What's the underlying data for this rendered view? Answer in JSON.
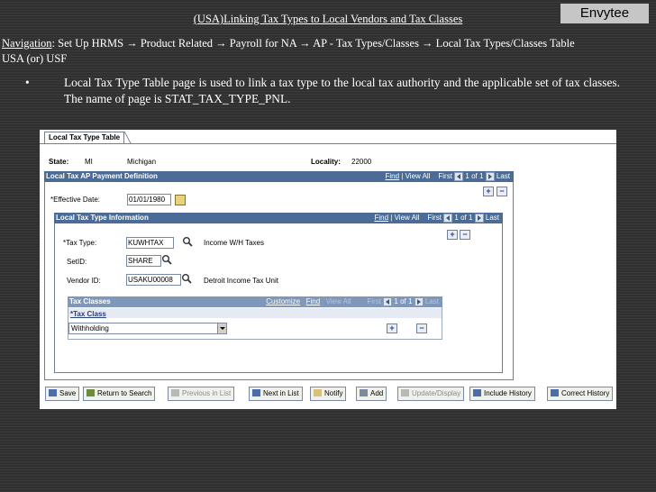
{
  "slide": {
    "title": "(USA)Linking Tax Types to Local Vendors and Tax Classes",
    "brand": "Envytee",
    "nav_label": "Navigation",
    "nav_text": ": Set Up HRMS → Product Related → Payroll for NA → AP - Tax Types/Classes → Local Tax Types/Classes Table USA (or) USF",
    "bullet": "Local Tax Type Table page is used to link a tax type to the local tax authority and the applicable set of tax classes. The name of page is STAT_TAX_TYPE_PNL."
  },
  "page": {
    "tab": "Local Tax Type Table",
    "state_label": "State:",
    "state_code": "MI",
    "state_name": "Michigan",
    "locality_label": "Locality:",
    "locality_value": "22000",
    "ap_section": {
      "title": "Local Tax AP Payment Definition",
      "find": "Find",
      "view_all": "View All",
      "first": "First",
      "count": "1 of 1",
      "last": "Last",
      "effdt_label": "*Effective Date:",
      "effdt_value": "01/01/1980"
    },
    "info_section": {
      "title": "Local Tax Type Information",
      "find": "Find",
      "view_all": "View All",
      "first": "First",
      "count": "1 of 1",
      "last": "Last",
      "tax_type_label": "*Tax Type:",
      "tax_type_value": "KUWHTAX",
      "tax_type_desc": "Income W/H Taxes",
      "setid_label": "SetID:",
      "setid_value": "SHARE",
      "vendor_label": "Vendor ID:",
      "vendor_value": "USAKU00008",
      "vendor_desc": "Detroit Income Tax Unit"
    },
    "classes_section": {
      "title": "Tax Classes",
      "customize": "Customize",
      "find": "Find",
      "view_all": "View All",
      "first": "First",
      "count": "1 of 1",
      "last": "Last",
      "col_header": "*Tax Class",
      "value": "Withholding"
    },
    "toolbar": {
      "save": "Save",
      "return": "Return to Search",
      "prev": "Previous in List",
      "next": "Next in List",
      "notify": "Notify",
      "add": "Add",
      "update": "Update/Display",
      "include_history": "Include History",
      "correct_history": "Correct History"
    }
  }
}
